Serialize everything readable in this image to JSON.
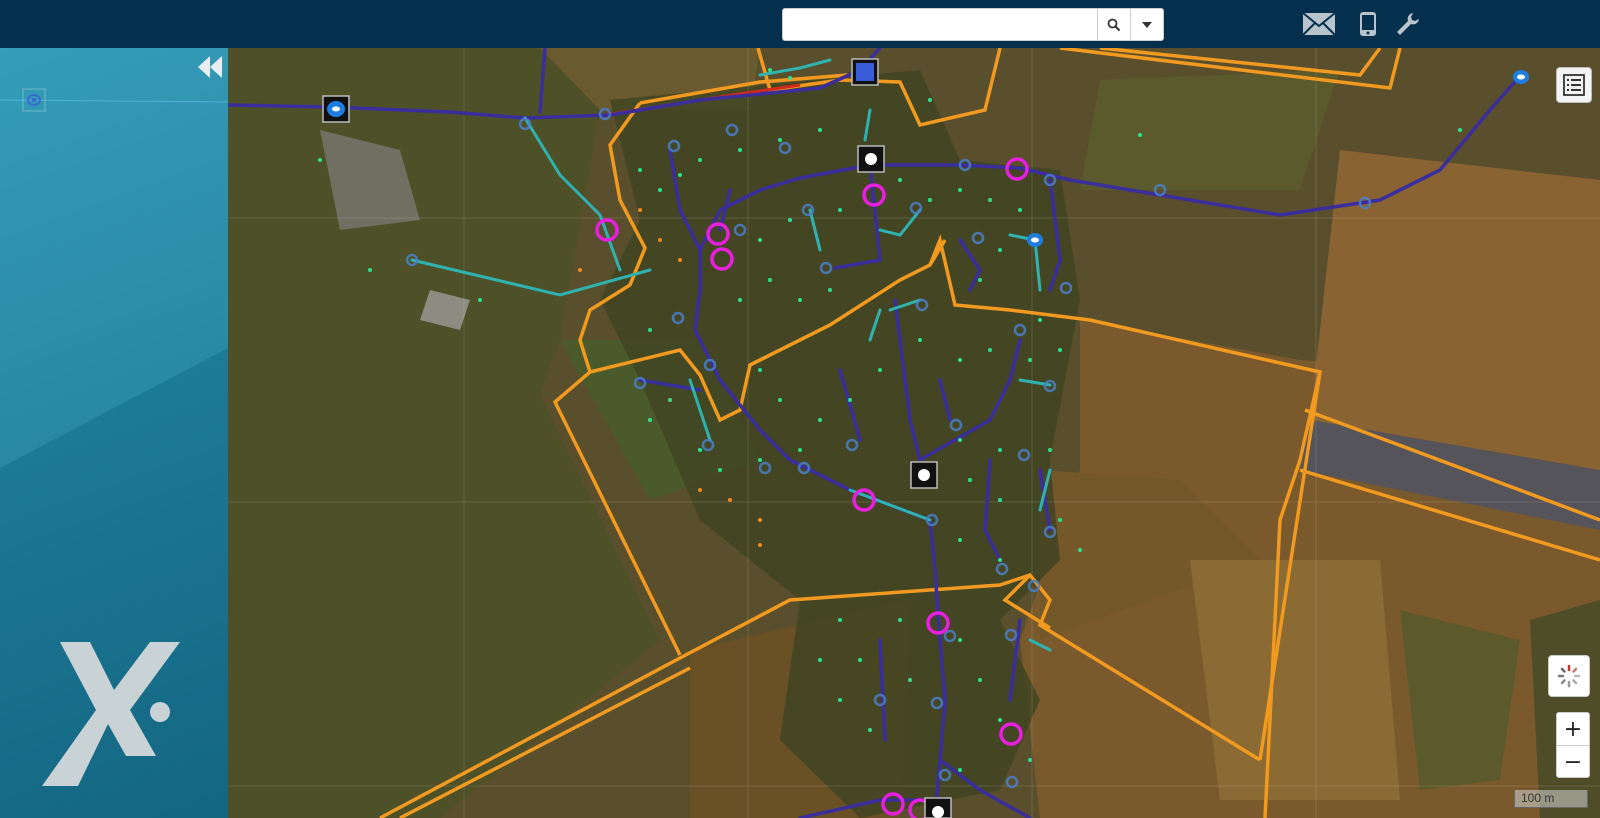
{
  "header": {
    "search": {
      "value": "",
      "placeholder": ""
    },
    "icons": [
      "search-icon",
      "chevron-down-icon",
      "envelope-icon",
      "mobile-phone-icon",
      "wrench-icon"
    ]
  },
  "sidebar": {
    "icons": [
      "double-chevron-left-icon",
      "layer-marker-icon",
      "brand-logo-icon"
    ]
  },
  "map_controls": {
    "zoom_in_label": "+",
    "zoom_out_label": "−",
    "scale_label": "100 m",
    "icons": [
      "legend-list-icon",
      "loading-spinner-icon"
    ]
  },
  "colors": {
    "header_bg": "#04304e",
    "sidebar_bg": "#1d7f9d",
    "boundary": "#f29a1f",
    "main_line": "#3a2d9c",
    "service_line": "#2eb3b0",
    "highlight_ring": "#e91ee0",
    "node_blue": "#1e7de0",
    "property_dot": "#2ee08f"
  }
}
